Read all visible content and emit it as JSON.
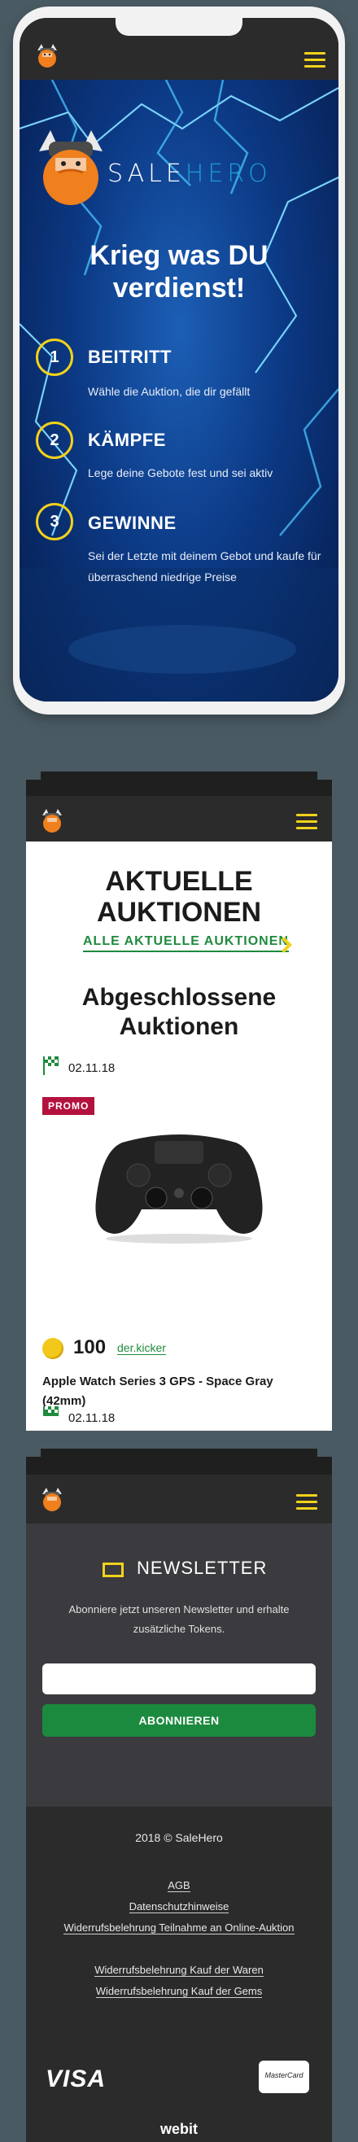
{
  "colors": {
    "accent": "#f2d21b",
    "brand_blue": "#1e9bd2",
    "green": "#1f8a3d",
    "promo": "#b3123e",
    "header": "#2b2b2b"
  },
  "icons": {
    "menu": "hamburger-menu-icon",
    "logo": "viking-mascot-logo",
    "flag": "checkered-flag-icon",
    "coin": "gold-coin-icon",
    "chevron": "chevron-right-icon",
    "newsletter": "envelope-outline-icon"
  },
  "hero": {
    "brand_sale": "SALE",
    "brand_hero": "HERO",
    "title_line1": "Krieg was DU",
    "title_line2": "verdienst!",
    "steps": [
      {
        "number": "1",
        "title": "BEITRITT",
        "text": "Wähle die Auktion, die dir gefällt"
      },
      {
        "number": "2",
        "title": "KÄMPFE",
        "text": "Lege deine Gebote fest und sei aktiv"
      },
      {
        "number": "3",
        "title": "GEWINNE",
        "text": "Sei der Letzte mit deinem Gebot und kaufe für überraschend niedrige Preise"
      }
    ]
  },
  "auctions": {
    "title_line1": "AKTUELLE",
    "title_line2": "AUKTIONEN",
    "all_link": "ALLE AKTUELLE AUKTIONEN",
    "closed_title_line1": "Abgeschlossene",
    "closed_title_line2": "Auktionen",
    "items": [
      {
        "date": "02.11.18",
        "badge": "PROMO",
        "price": "100",
        "bidder": "der.kicker",
        "name": "Apple Watch Series 3 GPS - Space Gray (42mm)"
      },
      {
        "date": "02.11.18"
      }
    ]
  },
  "newsletter": {
    "title": "NEWSLETTER",
    "text": "Abonniere jetzt unseren Newsletter und erhalte zusätzliche Tokens.",
    "input_value": "",
    "input_placeholder": "",
    "button": "ABONNIEREN"
  },
  "footer": {
    "copyright": "2018 © SaleHero",
    "links": [
      "AGB",
      "Datenschutzhinweise",
      "Widerrufsbelehrung Teilnahme an Online-Auktion",
      "Widerrufsbelehrung Kauf der Waren",
      "Widerrufsbelehrung Kauf der Gems"
    ],
    "visa": "VISA",
    "mastercard": "MasterCard",
    "webit": "webit"
  }
}
